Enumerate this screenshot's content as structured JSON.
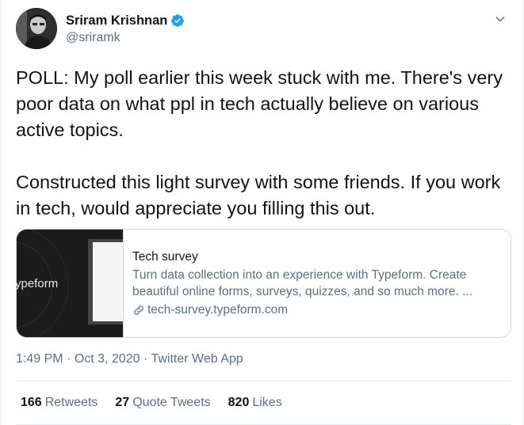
{
  "user": {
    "display_name": "Sriram Krishnan",
    "handle": "@sriramk",
    "verified_icon": "verified-badge-icon",
    "avatar_icon": "avatar"
  },
  "tweet": {
    "text": "POLL: My poll earlier this week stuck with me. There's very poor data on what ppl in tech actually believe on various active topics.\n\nConstructed this light survey with some friends. If you work in tech, would appreciate you filling this out."
  },
  "card": {
    "media_text": "ypeform",
    "title": "Tech survey",
    "description": "Turn data collection into an experience with Typeform. Create beautiful online forms, surveys, quizzes, and so much more. ...",
    "domain": "tech-survey.typeform.com"
  },
  "meta": {
    "time": "1:49 PM",
    "sep1": " · ",
    "date": "Oct 3, 2020",
    "sep2": " · ",
    "source": "Twitter Web App"
  },
  "stats": {
    "retweets_count": "166",
    "retweets_label": "Retweets",
    "quotes_count": "27",
    "quotes_label": "Quote Tweets",
    "likes_count": "820",
    "likes_label": "Likes"
  },
  "colors": {
    "accent": "#1da1f2",
    "text": "#0f1419",
    "secondary": "#5b7083",
    "border": "#e6ecf0"
  }
}
